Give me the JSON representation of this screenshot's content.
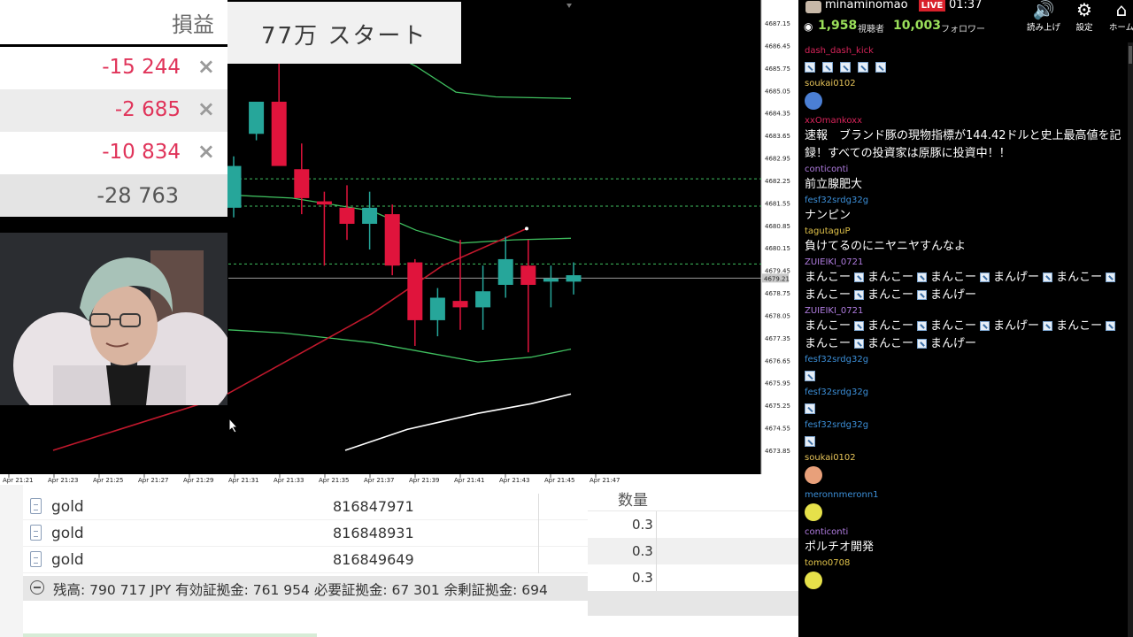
{
  "pnl_panel": {
    "header": "損益",
    "rows": [
      {
        "value": "-15 244",
        "close": "×"
      },
      {
        "value": "-2 685",
        "close": "×"
      },
      {
        "value": "-10 834",
        "close": "×"
      }
    ],
    "total": "-28 763"
  },
  "overlay_label": "77万 スタート",
  "chart_data": {
    "type": "candlestick",
    "symbol": "gold",
    "y_ticks": [
      "4687.15",
      "4686.45",
      "4685.75",
      "4685.05",
      "4684.35",
      "4683.65",
      "4682.95",
      "4682.25",
      "4681.55",
      "4680.85",
      "4680.15",
      "4679.45",
      "4678.75",
      "4678.05",
      "4677.35",
      "4676.65",
      "4675.95",
      "4675.25",
      "4674.55",
      "4673.85"
    ],
    "current_price_label": "4679.21",
    "x_ticks": [
      "Apr 21:21",
      "Apr 21:23",
      "Apr 21:25",
      "Apr 21:27",
      "Apr 21:29",
      "Apr 21:31",
      "Apr 21:33",
      "Apr 21:35",
      "Apr 21:37",
      "Apr 21:39",
      "Apr 21:41",
      "Apr 21:43",
      "Apr 21:45",
      "Apr 21:47"
    ],
    "candles": [
      {
        "o": 4681.4,
        "h": 4683.0,
        "l": 4681.1,
        "c": 4682.7
      },
      {
        "o": 4683.7,
        "h": 4684.6,
        "l": 4683.5,
        "c": 4684.7
      },
      {
        "o": 4684.7,
        "h": 4685.9,
        "l": 4682.8,
        "c": 4682.7
      },
      {
        "o": 4682.6,
        "h": 4683.4,
        "l": 4681.2,
        "c": 4681.7
      },
      {
        "o": 4681.6,
        "h": 4681.9,
        "l": 4679.6,
        "c": 4681.5
      },
      {
        "o": 4681.4,
        "h": 4682.1,
        "l": 4680.4,
        "c": 4680.9
      },
      {
        "o": 4680.9,
        "h": 4681.9,
        "l": 4680.1,
        "c": 4681.4
      },
      {
        "o": 4681.2,
        "h": 4681.5,
        "l": 4679.3,
        "c": 4679.6
      },
      {
        "o": 4679.7,
        "h": 4679.8,
        "l": 4677.1,
        "c": 4677.9
      },
      {
        "o": 4677.9,
        "h": 4678.9,
        "l": 4677.4,
        "c": 4678.6
      },
      {
        "o": 4678.5,
        "h": 4680.4,
        "l": 4677.6,
        "c": 4678.3
      },
      {
        "o": 4678.3,
        "h": 4679.6,
        "l": 4677.6,
        "c": 4678.8
      },
      {
        "o": 4679.0,
        "h": 4680.5,
        "l": 4678.6,
        "c": 4679.8
      },
      {
        "o": 4679.6,
        "h": 4680.4,
        "l": 4676.9,
        "c": 4679.0
      },
      {
        "o": 4679.1,
        "h": 4679.6,
        "l": 4678.3,
        "c": 4679.2
      },
      {
        "o": 4679.1,
        "h": 4679.7,
        "l": 4678.7,
        "c": 4679.3
      }
    ],
    "hlines": [
      4682.3,
      4681.45,
      4679.65
    ],
    "grid": false,
    "colors": {
      "background": "#000000",
      "bull": "#26a69a",
      "bear": "#e0143c",
      "band": "#3fbf5f",
      "trend": "#c0182c",
      "ma": "#ffffff"
    }
  },
  "orders": {
    "rows": [
      {
        "symbol": "gold",
        "ticket": "816847971",
        "qty": "0.3"
      },
      {
        "symbol": "gold",
        "ticket": "816848931",
        "qty": "0.3"
      },
      {
        "symbol": "gold",
        "ticket": "816849649",
        "qty": "0.3"
      }
    ],
    "qty_header": "数量",
    "balance_text": "残高: 790 717 JPY  有効証拠金: 761 954  必要証拠金: 67 301  余剰証拠金: 694"
  },
  "stream": {
    "streamer": "minaminomao",
    "live_badge": "LIVE",
    "time": "01:37",
    "viewers": "1,958",
    "viewers_label": "視聴者",
    "followers": "10,003",
    "followers_label": "フォロワー",
    "tools": [
      {
        "icon": "speaker-icon",
        "label": "読み上げ"
      },
      {
        "icon": "gear-icon",
        "label": "設定"
      },
      {
        "icon": "home-icon",
        "label": "ホーム"
      }
    ]
  },
  "chat": [
    {
      "user": "dash_dash_kick",
      "color": "#d8245a",
      "type": "emotes",
      "count": 5
    },
    {
      "user": "soukai0102",
      "color": "#e8c55a",
      "type": "sticker",
      "sticker": "#4b7fd4"
    },
    {
      "user": "xxOmankoxx",
      "color": "#d8245a",
      "type": "text",
      "text": "速報　ブランド豚の現物指標が144.42ドルと史上最高値を記録！すべての投資家は原豚に投資中！！"
    },
    {
      "user": "conticonti",
      "color": "#b07ce0",
      "type": "text",
      "text": "前立腺肥大"
    },
    {
      "user": "fesf32srdg32g",
      "color": "#3c8fd8",
      "type": "text",
      "text": "ナンピン"
    },
    {
      "user": "tagutaguP",
      "color": "#e0c24a",
      "type": "text",
      "text": "負けてるのにニヤニヤすんなよ"
    },
    {
      "user": "ZUIEIKI_0721",
      "color": "#b07ce0",
      "type": "mixed",
      "parts": [
        "まんこー",
        "まんこー",
        "まんこー",
        "まんげー",
        "まんこー",
        "まんこー",
        "まんこー",
        "まんげー"
      ]
    },
    {
      "user": "ZUIEIKI_0721",
      "color": "#b07ce0",
      "type": "mixed",
      "parts": [
        "まんこー",
        "まんこー",
        "まんこー",
        "まんげー",
        "まんこー",
        "まんこー",
        "まんこー",
        "まんげー"
      ]
    },
    {
      "user": "fesf32srdg32g",
      "color": "#3c8fd8",
      "type": "emotes",
      "count": 1
    },
    {
      "user": "fesf32srdg32g",
      "color": "#3c8fd8",
      "type": "emotes",
      "count": 1
    },
    {
      "user": "fesf32srdg32g",
      "color": "#3c8fd8",
      "type": "emotes",
      "count": 1
    },
    {
      "user": "soukai0102",
      "color": "#e8c55a",
      "type": "sticker",
      "sticker": "#e8a07a"
    },
    {
      "user": "meronnmeronn1",
      "color": "#3c8fd8",
      "type": "sticker",
      "sticker": "#e6e14a"
    },
    {
      "user": "conticonti",
      "color": "#b07ce0",
      "type": "text",
      "text": "ポルチオ開発"
    },
    {
      "user": "tomo0708",
      "color": "#e0c24a",
      "type": "sticker",
      "sticker": "#e6e14a"
    }
  ]
}
